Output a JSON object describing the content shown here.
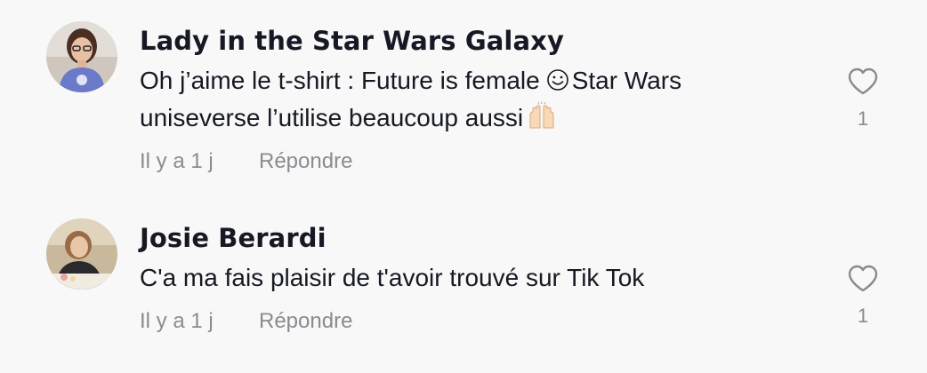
{
  "comments": [
    {
      "username": "Lady in the Star Wars Galaxy",
      "text_line1_before_icon": "Oh j’aime le t-shirt : Future is female",
      "text_line1_after_icon": "Star Wars",
      "text_line2": "uniseverse l’utilise beaucoup aussi",
      "time": "Il y a 1 j",
      "reply_label": "Répondre",
      "like_count": "1",
      "icons": [
        "smiley-emoji",
        "raising-hands-emoji"
      ]
    },
    {
      "username": "Josie Berardi",
      "text": "C'a ma fais plaisir de t'avoir trouvé sur Tik Tok",
      "time": "Il y a 1 j",
      "reply_label": "Répondre",
      "like_count": "1"
    }
  ],
  "colors": {
    "background": "#f8f8f8",
    "primary_text": "#161823",
    "secondary_text": "#8a8b91",
    "heart_outline": "#8a8b91"
  }
}
